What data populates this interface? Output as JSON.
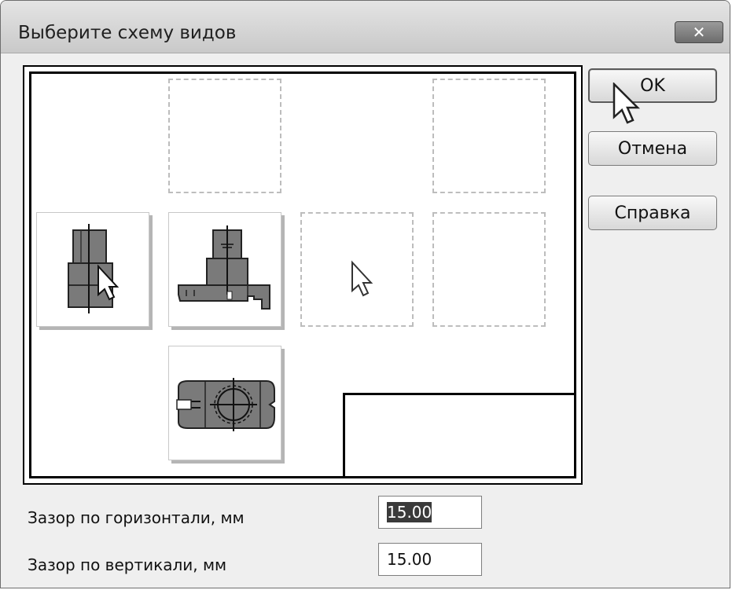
{
  "window": {
    "title": "Выберите схему видов",
    "close_icon": "close-icon"
  },
  "buttons": {
    "ok_label": "OK",
    "cancel_label": "Отмена",
    "help_label": "Справка"
  },
  "gap_horizontal": {
    "label": "Зазор по горизонтали, мм",
    "value": "15.00",
    "selected": true
  },
  "gap_vertical": {
    "label": "Зазор по вертикали, мм",
    "value": "15.00"
  },
  "layout_scheme": {
    "cells": [
      {
        "row": 1,
        "col": 2,
        "state": "available"
      },
      {
        "row": 1,
        "col": 4,
        "state": "available"
      },
      {
        "row": 2,
        "col": 1,
        "state": "view",
        "view": "left-view"
      },
      {
        "row": 2,
        "col": 2,
        "state": "view",
        "view": "front-view"
      },
      {
        "row": 2,
        "col": 3,
        "state": "available",
        "pointer": "arrow-cursor-icon"
      },
      {
        "row": 2,
        "col": 4,
        "state": "available"
      },
      {
        "row": 3,
        "col": 2,
        "state": "view",
        "view": "top-view"
      }
    ]
  }
}
